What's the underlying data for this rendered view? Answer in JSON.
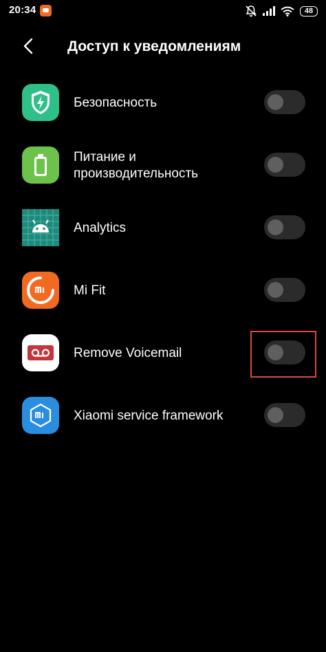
{
  "status_bar": {
    "time": "20:34",
    "battery": "48",
    "icons": [
      "app-notification-icon",
      "mute-icon",
      "signal-icon",
      "wifi-icon",
      "battery-icon"
    ]
  },
  "header": {
    "back_icon": "back-arrow-icon",
    "title": "Доступ к уведомлениям"
  },
  "apps": [
    {
      "label": "Безопасность",
      "icon": "security-shield-icon",
      "enabled": false
    },
    {
      "label": "Питание и производительность",
      "icon": "battery-power-icon",
      "enabled": false
    },
    {
      "label": "Analytics",
      "icon": "android-analytics-icon",
      "enabled": false
    },
    {
      "label": "Mi Fit",
      "icon": "mi-fit-icon",
      "enabled": false
    },
    {
      "label": "Remove Voicemail",
      "icon": "voicemail-icon",
      "enabled": false,
      "highlighted": true
    },
    {
      "label": "Xiaomi service framework",
      "icon": "xiaomi-service-icon",
      "enabled": false
    }
  ],
  "colors": {
    "background": "#000000",
    "toggle_track": "#2b2b2b",
    "toggle_knob": "#5f5f5f",
    "highlight": "#d94a3d"
  }
}
